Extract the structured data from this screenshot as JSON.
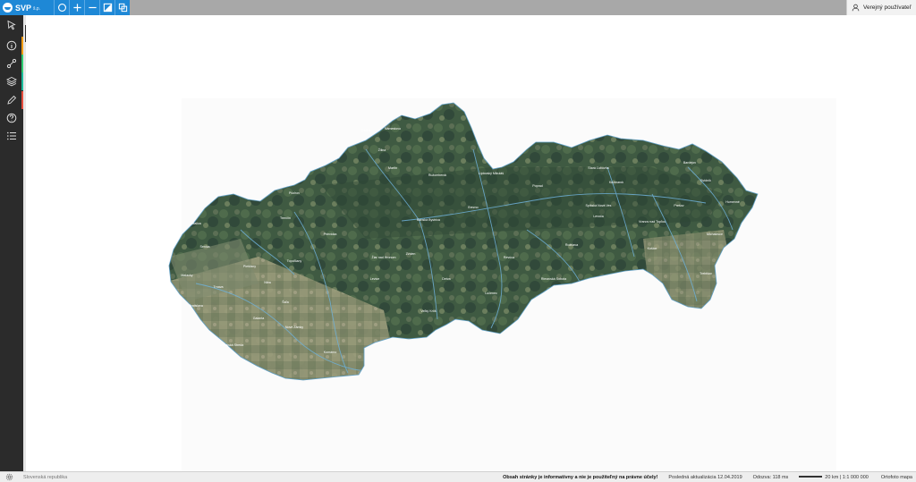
{
  "app": {
    "brand_name": "SVP",
    "brand_sub": "š.p."
  },
  "toolbar": {
    "tools": [
      {
        "name": "search-tool",
        "icon": "magnifier-icon"
      },
      {
        "name": "zoom-in-tool",
        "icon": "plus-icon"
      },
      {
        "name": "zoom-out-tool",
        "icon": "minus-icon"
      },
      {
        "name": "basemap-tool",
        "icon": "layers-square-icon"
      },
      {
        "name": "window-tool",
        "icon": "windows-icon"
      }
    ]
  },
  "user": {
    "label": "Verejný používateľ",
    "icon": "user-icon"
  },
  "sidebar": {
    "items": [
      {
        "name": "select-tool",
        "icon": "cursor-icon",
        "accent": ""
      },
      {
        "name": "info-tool",
        "icon": "info-icon",
        "accent": "#f39c12"
      },
      {
        "name": "measure-tool",
        "icon": "route-icon",
        "accent": "#2ecc71"
      },
      {
        "name": "layers-tool",
        "icon": "layers-icon",
        "accent": "#1abc9c"
      },
      {
        "name": "draw-tool",
        "icon": "pencil-icon",
        "accent": "#e74c3c"
      },
      {
        "name": "help-tool",
        "icon": "help-icon",
        "accent": ""
      },
      {
        "name": "legend-tool",
        "icon": "list-icon",
        "accent": ""
      }
    ]
  },
  "map": {
    "labels": [
      "Žilina",
      "Martin",
      "Poprad",
      "Prešov",
      "Košice",
      "Banská Bystrica",
      "Zvolen",
      "Nitra",
      "Trnava",
      "Bratislava",
      "Trenčín",
      "Lučenec",
      "Rožňava",
      "Humenné",
      "Michalovce",
      "Bardejov",
      "Senica",
      "Levice",
      "Komárno",
      "Dunajská Streda",
      "Prievidza",
      "Ružomberok",
      "Liptovský Mikuláš",
      "Spišská Nová Ves",
      "Rimavská Sobota",
      "Nové Zámky",
      "Topoľčany",
      "Piešťany",
      "Púchov",
      "Čadca",
      "Námestovo",
      "Stará Ľubovňa",
      "Svidník",
      "Vranov nad Topľou",
      "Trebišov",
      "Galanta",
      "Šaľa",
      "Malacky",
      "Skalica",
      "Žiar nad Hronom",
      "Brezno",
      "Revúca",
      "Veľký Krtíš",
      "Detva",
      "Kežmarok",
      "Levoča"
    ]
  },
  "footer": {
    "region": "Slovenská republika",
    "disclaimer": "Obsah stránky je informatívny a nie je použiteľný na právne účely!",
    "last_update": "Posledná aktualizácia 12.04.2019",
    "response": "Odozva: 118 ms",
    "scale": "20 km | 1:1 000 000",
    "basemap": "Ortofoto mapa"
  }
}
